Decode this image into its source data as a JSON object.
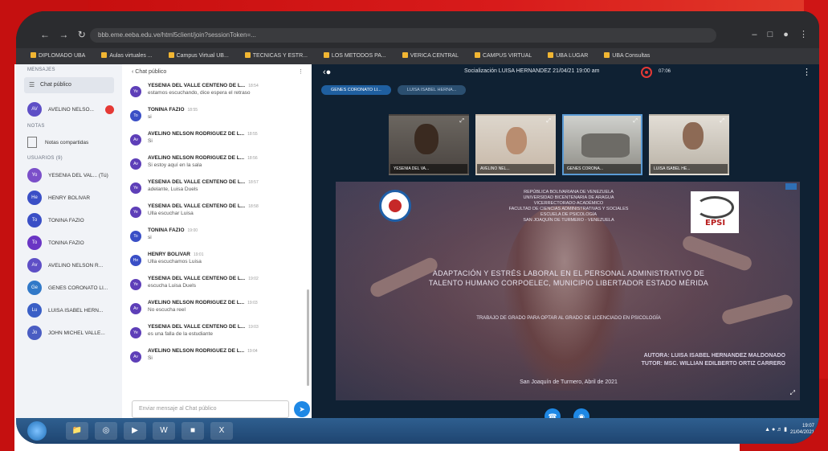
{
  "browser": {
    "url": "bbb.eme.eeba.edu.ve/html5client/join?sessionToken=...",
    "bookmarks": [
      "DIPLOMADO UBA",
      "Aulas virtuales ...",
      "Campus Virtual UB...",
      "TECNICAS Y ESTR...",
      "LOS METODOS PA...",
      "VERICA CENTRAL",
      "CAMPUS VIRTUAL",
      "UBA LUGAR",
      "UBA Consultas"
    ]
  },
  "left_panel": {
    "messages_heading": "MENSAJES",
    "public_chat_label": "Chat público",
    "private_chat": {
      "initials": "AV",
      "name": "AVELINO NELSO..."
    },
    "notes_heading": "NOTAS",
    "shared_notes_label": "Notas compartidas",
    "users_heading": "USUARIOS (9)",
    "users": [
      {
        "initials": "Yo",
        "name": "YESENIA DEL VAL... (Tú)",
        "color": "#7b4fc9"
      },
      {
        "initials": "He",
        "name": "HENRY BOLIVAR",
        "color": "#3a4fc6"
      },
      {
        "initials": "To",
        "name": "TONINA FAZIO",
        "color": "#3a4fc6"
      },
      {
        "initials": "To",
        "name": "TONINA FAZIO",
        "color": "#6a35c4"
      },
      {
        "initials": "Av",
        "name": "AVELINO NELSON R...",
        "color": "#5e4fc6"
      },
      {
        "initials": "Ge",
        "name": "GENES CORONATO LI...",
        "color": "#3179c8"
      },
      {
        "initials": "Lu",
        "name": "LUISA ISABEL HERN...",
        "color": "#3a5fc6"
      },
      {
        "initials": "Jo",
        "name": "JOHN MICHEL VALLE...",
        "color": "#4a5dc2"
      }
    ]
  },
  "chat": {
    "header": "Chat público",
    "messages": [
      {
        "initials": "Ye",
        "name": "YESENIA DEL VALLE CENTENO DE L...",
        "time": "18:54",
        "text": "estamos escuchando, dice espera el retraso",
        "color": "#5e3fb8"
      },
      {
        "initials": "To",
        "name": "TONINA FAZIO",
        "time": "18:55",
        "text": "si",
        "color": "#3a4fc6"
      },
      {
        "initials": "Av",
        "name": "AVELINO NELSON RODRIGUEZ DE L...",
        "time": "18:55",
        "text": "Si",
        "color": "#5e3fb8"
      },
      {
        "initials": "Av",
        "name": "AVELINO NELSON RODRIGUEZ DE L...",
        "time": "18:56",
        "text": "Si estoy aquí en la sala",
        "color": "#5e3fb8"
      },
      {
        "initials": "Ye",
        "name": "YESENIA DEL VALLE CENTENO DE L...",
        "time": "18:57",
        "text": "adelante, Luisa Duels",
        "color": "#5e3fb8"
      },
      {
        "initials": "Ye",
        "name": "YESENIA DEL VALLE CENTENO DE L...",
        "time": "18:58",
        "text": "Ulla escuchar Luisa",
        "color": "#5e3fb8"
      },
      {
        "initials": "To",
        "name": "TONINA FAZIO",
        "time": "19:00",
        "text": "si",
        "color": "#3a4fc6"
      },
      {
        "initials": "He",
        "name": "HENRY BOLIVAR",
        "time": "19:01",
        "text": "Ulla escuchamos Luisa",
        "color": "#3a4fc6"
      },
      {
        "initials": "Ye",
        "name": "YESENIA DEL VALLE CENTENO DE L...",
        "time": "19:02",
        "text": "escucha Luisa Duels",
        "color": "#5e3fb8"
      },
      {
        "initials": "Av",
        "name": "AVELINO NELSON RODRIGUEZ DE L...",
        "time": "19:03",
        "text": "No escucha reel",
        "color": "#5e3fb8"
      },
      {
        "initials": "Ye",
        "name": "YESENIA DEL VALLE CENTENO DE L...",
        "time": "19:03",
        "text": "es una falla de la estudiante",
        "color": "#5e3fb8"
      },
      {
        "initials": "Av",
        "name": "AVELINO NELSON RODRIGUEZ DE L...",
        "time": "19:04",
        "text": "Si",
        "color": "#5e3fb8"
      }
    ],
    "input_placeholder": "Enviar mensaje al Chat público"
  },
  "meeting": {
    "title": "Socialización LUISA HERNANDEZ 21/04/21 19:00 am",
    "recording_time": "07:06",
    "pills": [
      "GENES CORONATO LI...",
      "LUISA ISABEL HERNA..."
    ],
    "cameras": [
      "YESENIA DEL VA...",
      "AVELINO NEL...",
      "GENES CORONA...",
      "LUISA ISABEL HE..."
    ],
    "slide": {
      "institution": [
        "REPÚBLICA BOLIVARIANA DE VENEZUELA",
        "UNIVERSIDAD BICENTENARIA DE ARAGUA",
        "VICERRECTORADO ACADÉMICO",
        "FACULTAD DE CIENCIAS ADMINISTRATIVAS Y SOCIALES",
        "ESCUELA DE PSICOLOGÍA",
        "SAN JOAQUÍN DE TURMERO - VENEZUELA"
      ],
      "logo_text": "EPSI",
      "title": "ADAPTACIÓN Y ESTRÉS LABORAL EN EL PERSONAL ADMINISTRATIVO DE TALENTO HUMANO CORPOELEC, MUNICIPIO LIBERTADOR ESTADO MÉRIDA",
      "subtitle": "TRABAJO DE GRADO PARA OPTAR AL GRADO DE LICENCIADO EN PSICOLOGÍA",
      "author": "AUTORA: LUISA ISABEL HERNANDEZ MALDONADO",
      "tutor": "TUTOR: MSC. WILLIAN EDILBERTO ORTIZ CARRERO",
      "place_date": "San Joaquín de Turmero, Abril de 2021"
    }
  },
  "taskbar": {
    "clock_time": "19:07",
    "clock_date": "21/04/2021"
  },
  "colors": {
    "frame_red": "#c51010",
    "meeting_bg": "#0f2133",
    "accent_blue": "#1e88e5"
  }
}
